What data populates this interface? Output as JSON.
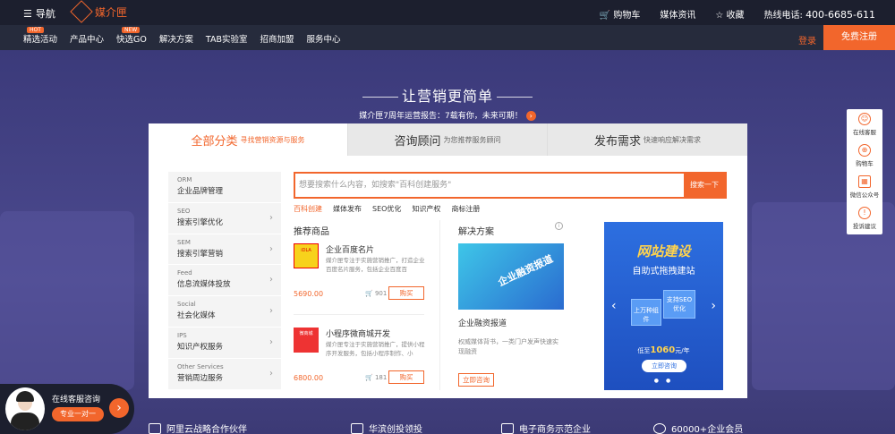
{
  "topbar": {
    "nav_label": "导航",
    "logo_text": "媒介匣",
    "cart": "购物车",
    "news": "媒体资讯",
    "favorite": "收藏",
    "hotline_label": "热线电话:",
    "hotline": "400-6685-611"
  },
  "mainnav": {
    "items": [
      "精选活动",
      "产品中心",
      "快选GO",
      "解决方案",
      "TAB实验室",
      "招商加盟",
      "服务中心"
    ],
    "badges": {
      "hot": "HOT",
      "new": "NEW"
    },
    "login": "登录",
    "register": "免费注册"
  },
  "hero": {
    "title": "让营销更简单",
    "subtitle": "媒介匣7周年运营报告：7载有你，未来可期！",
    "go": "›"
  },
  "tabs": [
    {
      "label": "全部分类",
      "sub": "寻找营销资源与服务"
    },
    {
      "label": "咨询顾问",
      "sub": "为您推荐服务顾问"
    },
    {
      "label": "发布需求",
      "sub": "快速响应解决需求"
    }
  ],
  "categories": [
    {
      "en": "ORM",
      "zh": "企业品牌管理"
    },
    {
      "en": "SEO",
      "zh": "搜索引擎优化"
    },
    {
      "en": "SEM",
      "zh": "搜索引擎营销"
    },
    {
      "en": "Feed",
      "zh": "信息流媒体投放"
    },
    {
      "en": "Social",
      "zh": "社会化媒体"
    },
    {
      "en": "IPS",
      "zh": "知识产权服务"
    },
    {
      "en": "Other Services",
      "zh": "营销周边服务"
    }
  ],
  "search": {
    "placeholder": "想要搜索什么内容，如搜索\"百科创建服务\"",
    "button": "搜索一下",
    "tags": [
      "百科创建",
      "媒体发布",
      "SEO优化",
      "知识产权",
      "商标注册"
    ]
  },
  "recommend": {
    "title": "推荐商品",
    "products": [
      {
        "name": "企业百度名片",
        "desc": "媒介匣专注于实施营销推广，打造企业百度名片服务，包括企业百度百",
        "price": "5690.00",
        "count": "901",
        "buy": "购买",
        "thumb": "iDLA"
      },
      {
        "name": "小程序微商城开发",
        "desc": "媒介匣专注于实施营销推广，提供小程序开发服务，包括小程序制作、小",
        "price": "6800.00",
        "count": "181",
        "buy": "购买",
        "thumb": "微商城"
      }
    ]
  },
  "solution": {
    "title": "解决方案",
    "image_text": "企业融资报道",
    "name": "企业融资报道",
    "desc": "权威媒体背书，一类门户发声快速实现融资",
    "button": "立即咨询"
  },
  "banner": {
    "title": "网站建设",
    "subtitle": "自助式拖拽建站",
    "chip1": "上万种组件",
    "chip2": "支持SEO优化",
    "price_prefix": "低至",
    "price": "1060",
    "price_suffix": "元/年",
    "ask": "立即咨询",
    "prev": "‹",
    "next": "›",
    "dots": "● ●"
  },
  "sidebar": [
    {
      "label": "在线客服",
      "icon": "☺"
    },
    {
      "label": "购物车",
      "icon": "⊕"
    },
    {
      "label": "微信公众号",
      "icon": "▦"
    },
    {
      "label": "投诉建议",
      "icon": "!"
    }
  ],
  "chat": {
    "label": "在线客服咨询",
    "button": "专业一对一",
    "go": "›"
  },
  "partners": [
    {
      "label": "阿里云战略合作伙伴"
    },
    {
      "label": "华滨创投领投"
    },
    {
      "label": "电子商务示范企业"
    },
    {
      "label": "60000+企业会员"
    }
  ]
}
